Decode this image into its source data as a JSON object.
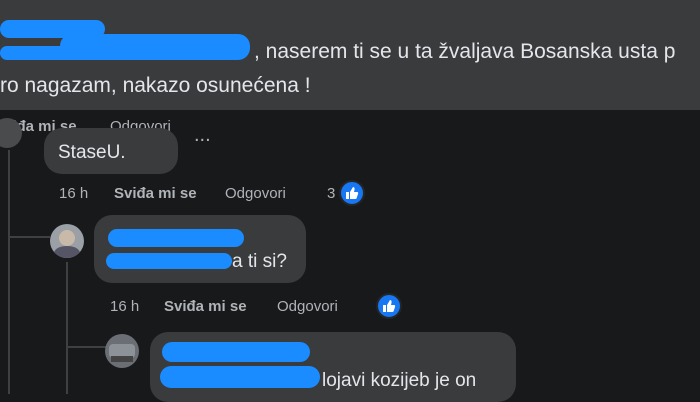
{
  "top_comment": {
    "line1": ", naserem ti se u ta žvaljava Bosanska usta p",
    "line2": "ro nagazam, nakazo osunećena !",
    "actions_partial": "Sviđa mi se",
    "reply_partial": "Odgovori",
    "more": "..."
  },
  "reply1": {
    "text": "StaseU.",
    "time": "16 h",
    "like_label": "Sviđa mi se",
    "reply_label": "Odgovori",
    "reaction_count": "3"
  },
  "reply2": {
    "text": "a ti si?",
    "time": "16 h",
    "like_label": "Sviđa mi se",
    "reply_label": "Odgovori"
  },
  "reply3": {
    "text": "lojavi kozijeb je on"
  },
  "colors": {
    "background": "#18191a",
    "bubble": "#3a3b3c",
    "like_blue": "#1877f2",
    "redaction": "#1a8cff"
  }
}
